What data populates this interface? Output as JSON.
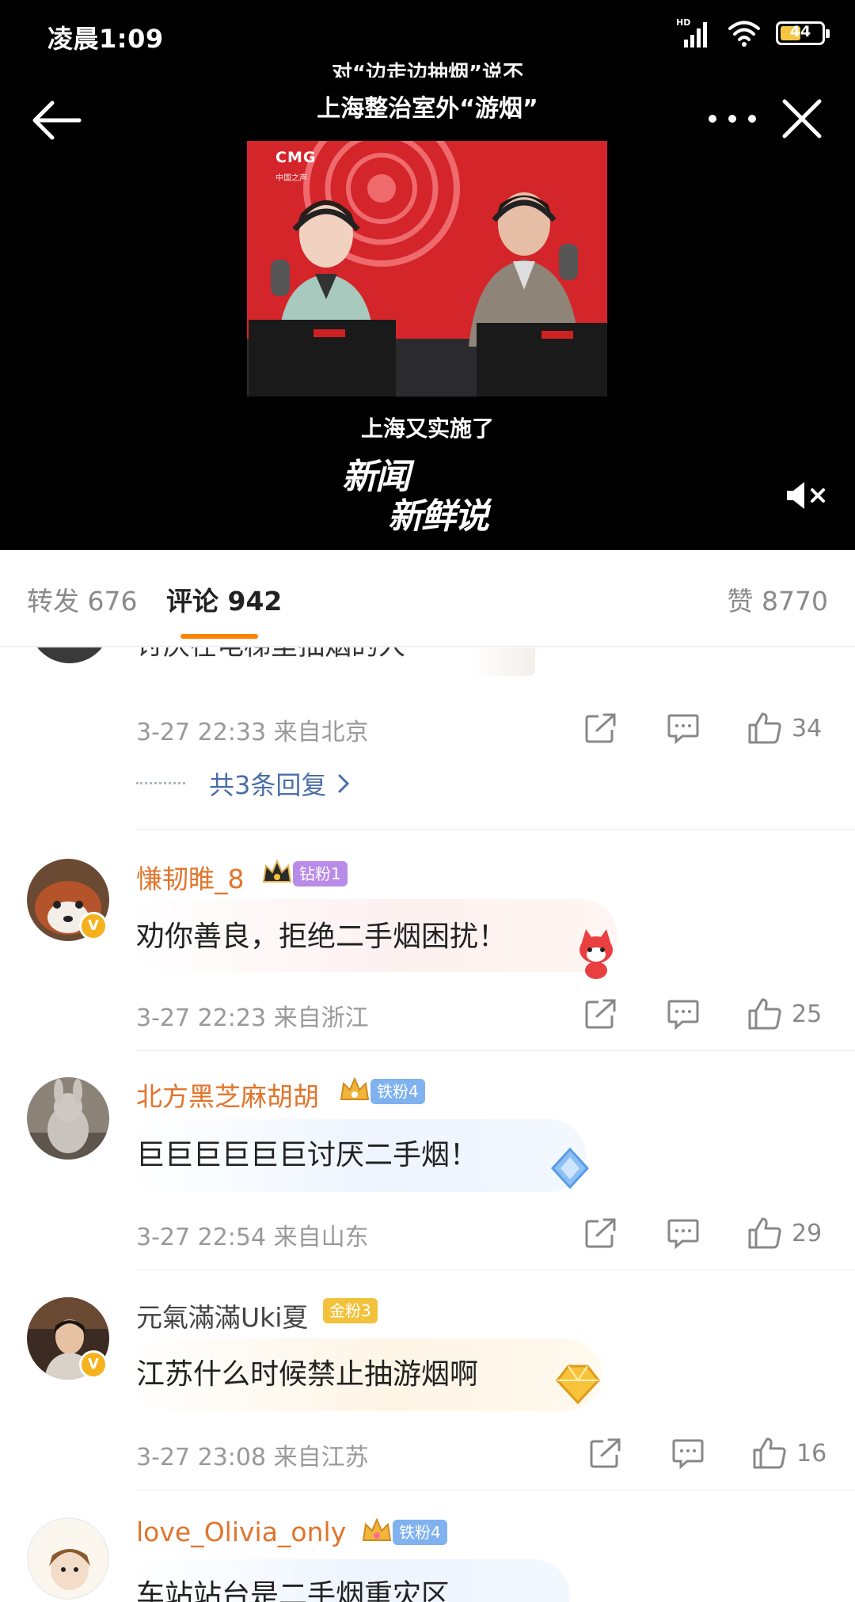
{
  "status_bar": {
    "time": "凌晨1:09",
    "network": "HD",
    "battery": "44"
  },
  "video": {
    "caption_cut": "对“边走边抽烟”说不",
    "caption_top": "上海整治室外“游烟”",
    "caption_sub": "上海又实施了",
    "brand_line1": "新闻",
    "brand_line2": "新鲜说",
    "frame_logo": "CMG",
    "frame_sub": "中国之声"
  },
  "tabs": {
    "repost": "转发 676",
    "comments": "评论 942",
    "likes": "赞 8770"
  },
  "colors": {
    "accent": "#ff8200",
    "username": "#e2742b",
    "link": "#4a6ea9"
  },
  "partial_comment": {
    "text": "讨厌在电梯里抽烟的人",
    "time_location": "3-27 22:33  来自北京",
    "likes": "34",
    "replies": "共3条回复"
  },
  "comments": [
    {
      "user": "慊韧睢_8",
      "fan_badge": "钻粉1",
      "text": "劝你善良，拒绝二手烟困扰！",
      "time_location": "3-27 22:23  来自浙江",
      "likes": "25"
    },
    {
      "user": "北方黑芝麻胡胡",
      "fan_badge": "铁粉4",
      "text": "巨巨巨巨巨巨讨厌二手烟！",
      "time_location": "3-27 22:54  来自山东",
      "likes": "29"
    },
    {
      "user": "元氣滿滿Uki夏",
      "fan_badge": "金粉3",
      "text": "江苏什么时候禁止抽游烟啊",
      "time_location": "3-27 23:08  来自江苏",
      "likes": "16"
    },
    {
      "user": "love_Olivia_only",
      "fan_badge": "铁粉4",
      "text": "车站站台是二手烟重灾区"
    }
  ]
}
